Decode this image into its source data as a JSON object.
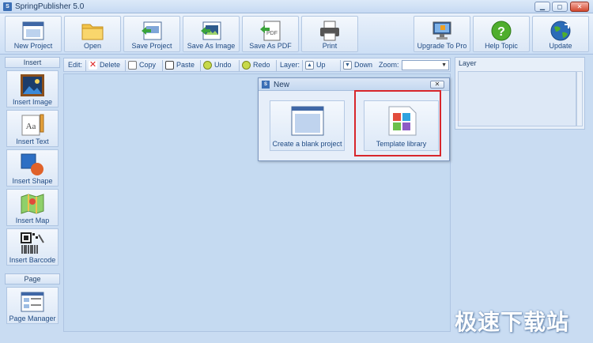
{
  "window": {
    "title": "SpringPublisher 5.0",
    "icon_text": "S"
  },
  "toolbar": {
    "buttons": [
      {
        "label": "New Project",
        "icon": "new-project-icon"
      },
      {
        "label": "Open",
        "icon": "folder-icon"
      },
      {
        "label": "Save Project",
        "icon": "save-project-icon"
      },
      {
        "label": "Save As Image",
        "icon": "save-image-icon"
      },
      {
        "label": "Save As PDF",
        "icon": "pdf-icon"
      },
      {
        "label": "Print",
        "icon": "printer-icon"
      },
      {
        "label": "Upgrade To Pro",
        "icon": "upgrade-icon"
      },
      {
        "label": "Help Topic",
        "icon": "help-icon"
      },
      {
        "label": "Update",
        "icon": "globe-update-icon"
      }
    ]
  },
  "insert_panel": {
    "header": "Insert",
    "items": [
      {
        "label": "Insert Image",
        "icon": "image-icon"
      },
      {
        "label": "Insert Text",
        "icon": "text-icon"
      },
      {
        "label": "Insert Shape",
        "icon": "shape-icon"
      },
      {
        "label": "Insert Map",
        "icon": "map-icon"
      },
      {
        "label": "Insert Barcode",
        "icon": "barcode-icon"
      }
    ]
  },
  "page_panel": {
    "header": "Page",
    "items": [
      {
        "label": "Page Manager",
        "icon": "page-manager-icon"
      }
    ]
  },
  "editbar": {
    "edit_label": "Edit:",
    "delete": "Delete",
    "copy": "Copy",
    "paste": "Paste",
    "undo": "Undo",
    "redo": "Redo",
    "layer_label": "Layer:",
    "up": "Up",
    "down": "Down",
    "zoom_label": "Zoom:",
    "zoom_value": ""
  },
  "layer_panel": {
    "header": "Layer"
  },
  "new_dialog": {
    "title": "New",
    "close_label": "✕",
    "options": [
      {
        "label": "Create a blank project",
        "icon": "blank-project-icon"
      },
      {
        "label": "Template library",
        "icon": "template-library-icon"
      }
    ]
  },
  "watermark": "极速下载站",
  "colors": {
    "background": "#c9dcf2",
    "accent": "#1f4a83",
    "highlight": "#d8262b"
  }
}
